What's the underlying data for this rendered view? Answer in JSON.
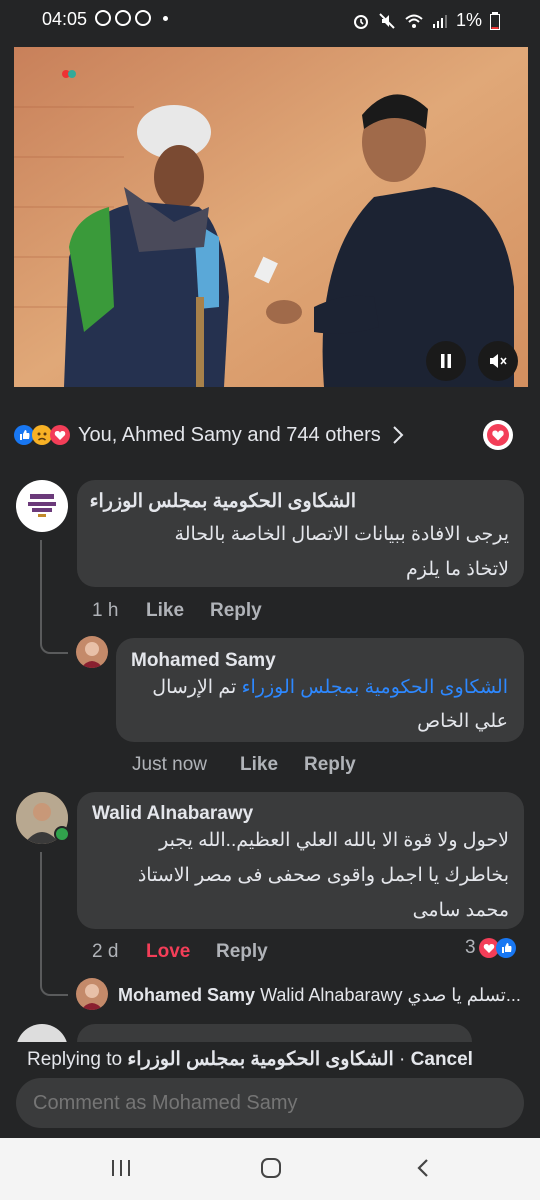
{
  "status_bar": {
    "time": "04:05",
    "battery": "1%"
  },
  "reactions": {
    "summary": "You, Ahmed Samy and 744 others"
  },
  "comments": [
    {
      "author": "الشكاوى الحكومية بمجلس الوزراء",
      "text_line1": "يرجى الافادة ببيانات الاتصال الخاصة بالحالة",
      "text_line2": "لاتخاذ ما يلزم",
      "time": "1 h",
      "like": "Like",
      "reply": "Reply"
    },
    {
      "author": "Mohamed Samy",
      "mention": "الشكاوى الحكومية بمجلس الوزراء",
      "text_after_mention": "تم الإرسال",
      "text_line2": "علي الخاص",
      "time": "Just now",
      "like": "Like",
      "reply": "Reply"
    },
    {
      "author": "Walid Alnabarawy",
      "text_line1": "لاحول ولا قوة الا بالله العلي العظيم..الله يجبر",
      "text_line2": "بخاطرك يا اجمل واقوى صحفى فى مصر الاستاذ",
      "text_line3": "محمد سامى",
      "time": "2 d",
      "love": "Love",
      "reply": "Reply",
      "reaction_count": "3"
    },
    {
      "author": "Mohamed Samy",
      "mention": "Walid Alnabarawy",
      "preview": "تسلم يا صدي..."
    }
  ],
  "reply_bar": {
    "replying_label": "Replying to",
    "replying_to": "الشكاوى الحكومية بمجلس الوزراء",
    "separator": "·",
    "cancel": "Cancel"
  },
  "composer": {
    "placeholder": "Comment as Mohamed Samy"
  },
  "colors": {
    "background": "#242526",
    "bubble": "#3a3b3c",
    "love": "#f33e58",
    "link": "#2d88ff",
    "like_blue": "#1877f2"
  }
}
